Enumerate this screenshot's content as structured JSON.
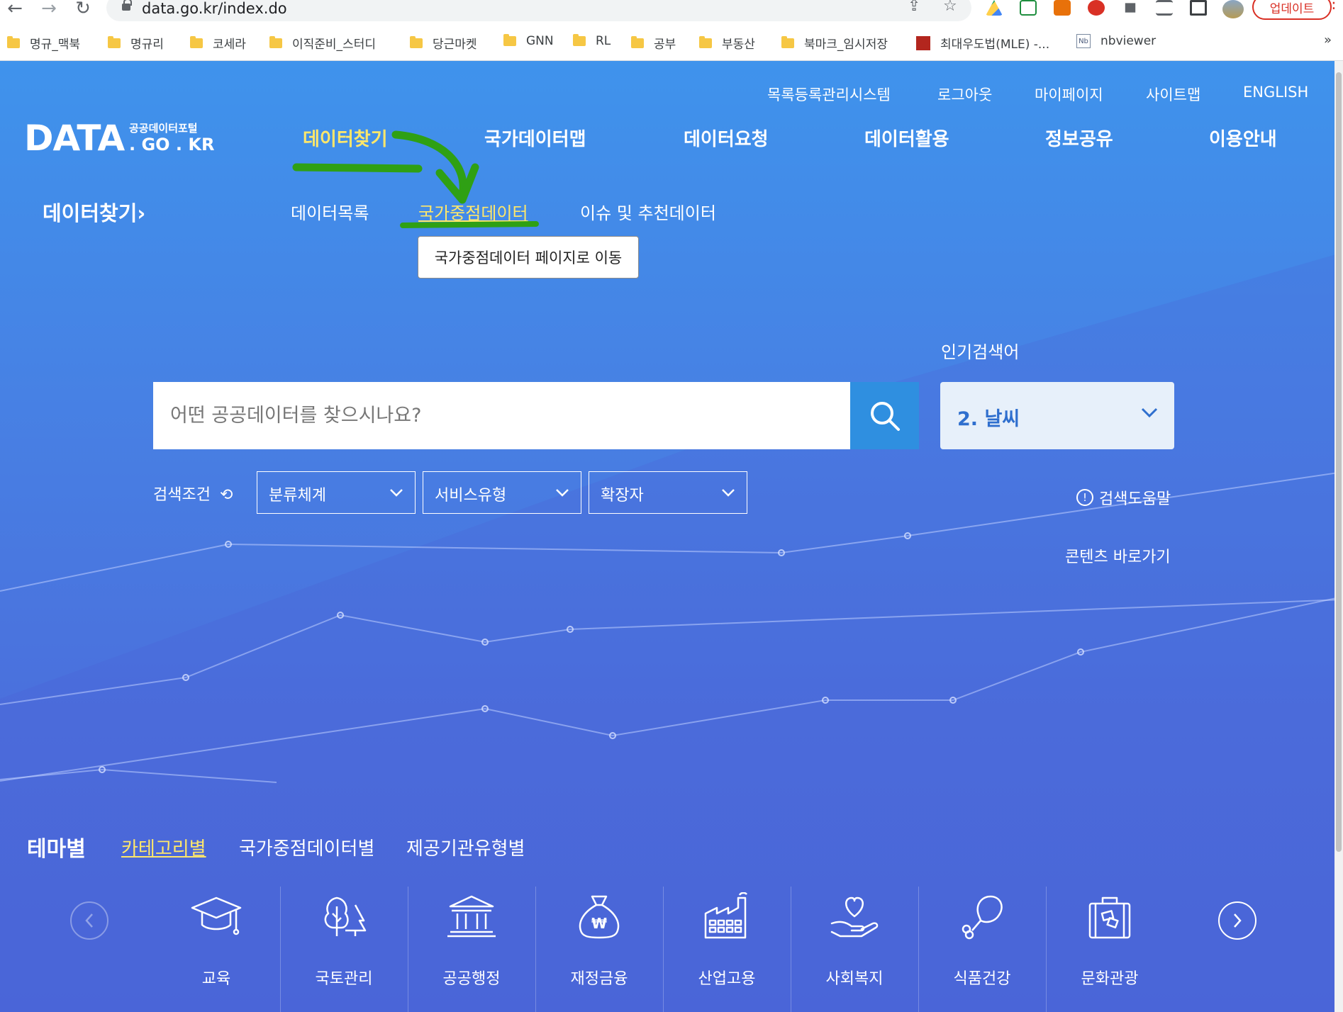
{
  "browser": {
    "url": "data.go.kr/index.do",
    "update_label": "업데이트",
    "bookmarks": [
      "명규_맥북",
      "명규리",
      "코세라",
      "이직준비_스터디",
      "당근마켓",
      "GNN",
      "RL",
      "공부",
      "부동산",
      "북마크_임시저장",
      "최대우도법(MLE) -...",
      "nbviewer"
    ],
    "bookmarks_more": "»"
  },
  "header": {
    "util_nav": [
      "목록등록관리시스템",
      "로그아웃",
      "마이페이지",
      "사이트맵",
      "ENGLISH"
    ],
    "logo": {
      "main": "DATA",
      "sub_top": "공공데이터포털",
      "sub_bottom": ". GO . KR"
    },
    "gnb": [
      "데이터찾기",
      "국가데이터맵",
      "데이터요청",
      "데이터활용",
      "정보공유",
      "이용안내"
    ],
    "gnb_active_index": 0
  },
  "subnav": {
    "section_title": "데이터찾기",
    "items": [
      "데이터목록",
      "국가중점데이터",
      "이슈 및 추천데이터"
    ],
    "hover_index": 1,
    "tooltip": "국가중점데이터 페이지로 이동"
  },
  "search": {
    "placeholder": "어떤 공공데이터를 찾으시나요?",
    "value": "",
    "popular_label": "인기검색어",
    "popular_value": "2. 날씨",
    "condition_label": "검색조건",
    "selects": [
      "분류체계",
      "서비스유형",
      "확장자"
    ],
    "help_label": "검색도움말",
    "shortcut_label": "콘텐츠 바로가기"
  },
  "themes": {
    "title": "테마별",
    "tabs": [
      "카테고리별",
      "국가중점데이터별",
      "제공기관유형별"
    ],
    "active_tab_index": 0,
    "categories": [
      {
        "label": "교육",
        "icon": "graduation-cap-icon"
      },
      {
        "label": "국토관리",
        "icon": "trees-icon"
      },
      {
        "label": "공공행정",
        "icon": "government-building-icon"
      },
      {
        "label": "재정금융",
        "icon": "money-bag-icon"
      },
      {
        "label": "산업고용",
        "icon": "factory-icon"
      },
      {
        "label": "사회복지",
        "icon": "heart-hand-icon"
      },
      {
        "label": "식품건강",
        "icon": "drumstick-icon"
      },
      {
        "label": "문화관광",
        "icon": "suitcase-icon"
      }
    ]
  },
  "colors": {
    "accent_yellow": "#ffe76a",
    "annotation_green": "#2fa014",
    "search_button": "#2f8fe0",
    "popular_text": "#2f6fce"
  }
}
